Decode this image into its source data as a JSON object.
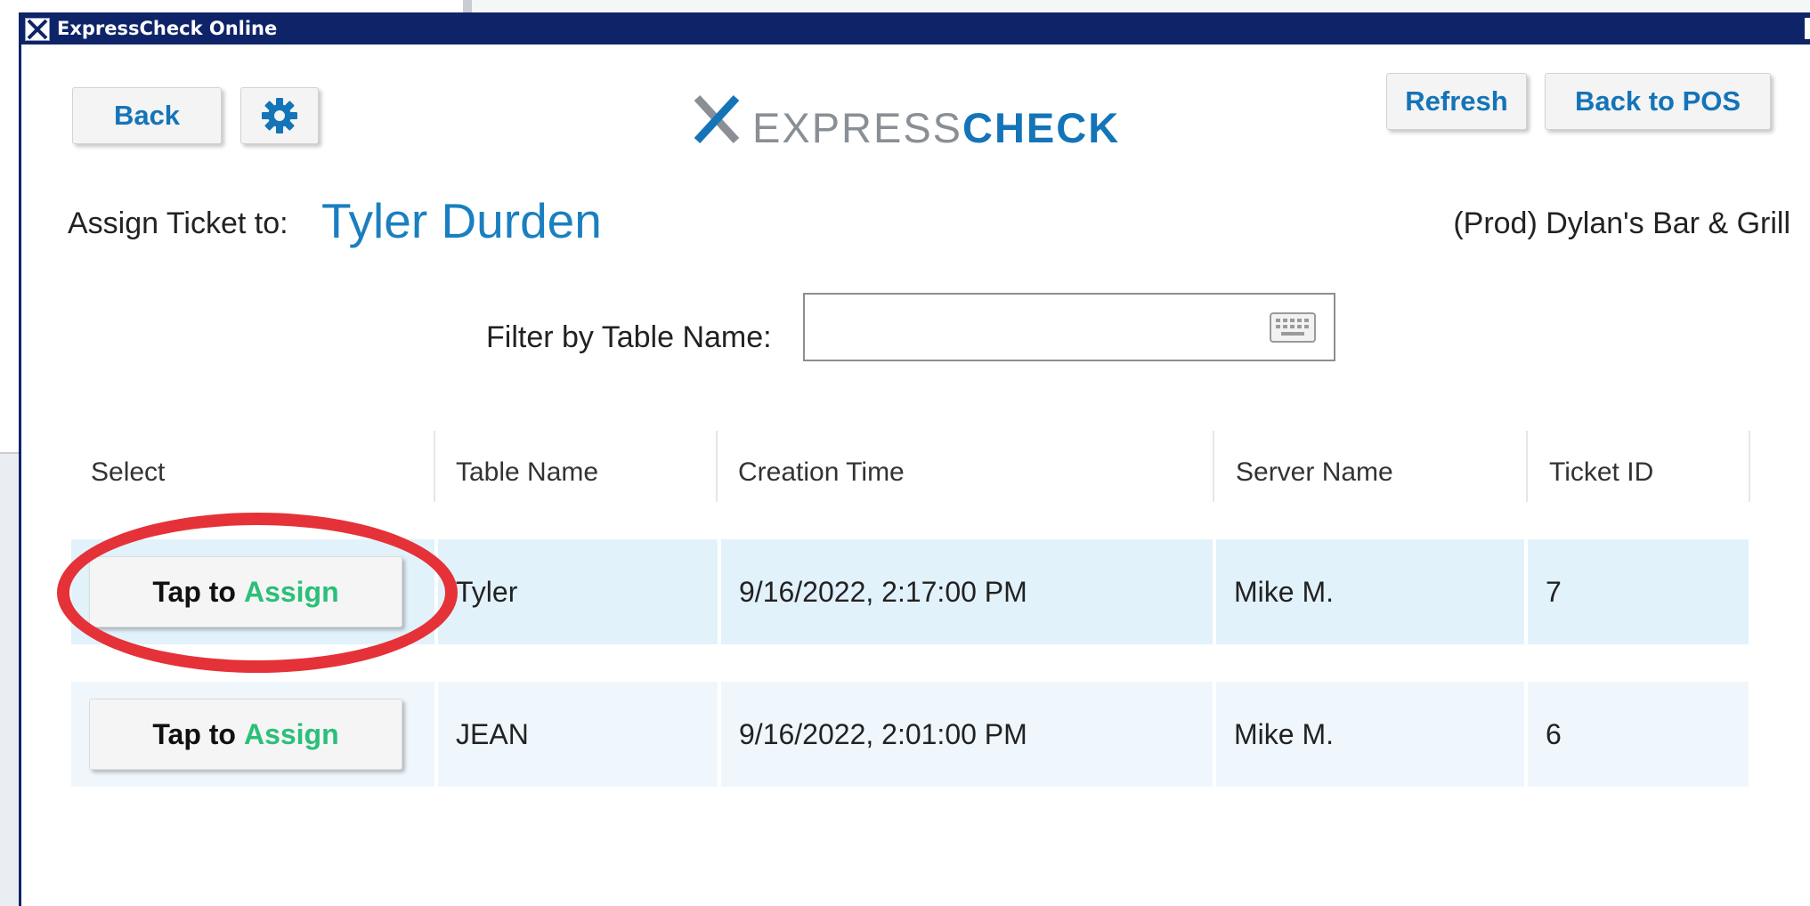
{
  "window": {
    "title": "ExpressCheck Online"
  },
  "toolbar": {
    "back_label": "Back",
    "settings_icon": "gear-icon",
    "refresh_label": "Refresh",
    "back_to_pos_label": "Back to POS"
  },
  "logo": {
    "word_light": "EXPRESS",
    "word_bold": "CHECK"
  },
  "assign": {
    "label": "Assign Ticket to:",
    "name": "Tyler Durden"
  },
  "store": {
    "name": "(Prod) Dylan's Bar & Grill"
  },
  "filter": {
    "label": "Filter by Table Name:",
    "value": "",
    "icon": "keyboard-icon"
  },
  "table": {
    "headers": [
      "Select",
      "Table Name",
      "Creation Time",
      "Server Name",
      "Ticket ID"
    ],
    "rows": [
      {
        "button_tap": "Tap to",
        "button_assign": "Assign",
        "table_name": "Tyler",
        "creation_time": "9/16/2022, 2:17:00 PM",
        "server_name": "Mike M.",
        "ticket_id": "7"
      },
      {
        "button_tap": "Tap to",
        "button_assign": "Assign",
        "table_name": "JEAN",
        "creation_time": "9/16/2022, 2:01:00 PM",
        "server_name": "Mike M.",
        "ticket_id": "6"
      }
    ]
  },
  "colors": {
    "titlebar": "#0f2468",
    "accent_blue": "#1474b8",
    "assign_green": "#2bbf7a",
    "highlight_red": "#e53238",
    "row_selected": "#e2f2fb",
    "row_alt": "#eff7fd"
  }
}
